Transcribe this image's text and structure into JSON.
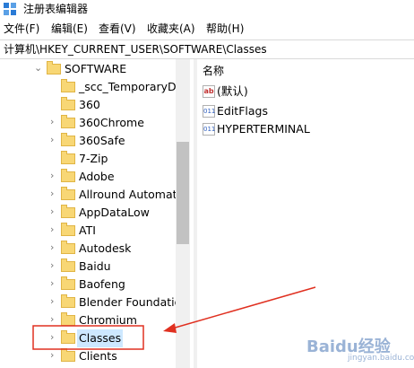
{
  "window": {
    "title": "注册表编辑器"
  },
  "menu": [
    "文件(F)",
    "编辑(E)",
    "查看(V)",
    "收藏夹(A)",
    "帮助(H)"
  ],
  "address": "计算机\\HKEY_CURRENT_USER\\SOFTWARE\\Classes",
  "tree": {
    "parent": "SOFTWARE",
    "items": [
      {
        "label": "_scc_TemporaryDa",
        "expandable": false
      },
      {
        "label": "360",
        "expandable": false
      },
      {
        "label": "360Chrome",
        "expandable": true
      },
      {
        "label": "360Safe",
        "expandable": true
      },
      {
        "label": "7-Zip",
        "expandable": false
      },
      {
        "label": "Adobe",
        "expandable": true
      },
      {
        "label": "Allround Automatio",
        "expandable": true
      },
      {
        "label": "AppDataLow",
        "expandable": true
      },
      {
        "label": "ATI",
        "expandable": true
      },
      {
        "label": "Autodesk",
        "expandable": true
      },
      {
        "label": "Baidu",
        "expandable": true
      },
      {
        "label": "Baofeng",
        "expandable": true
      },
      {
        "label": "Blender Foundation",
        "expandable": true
      },
      {
        "label": "Chromium",
        "expandable": true
      },
      {
        "label": "Classes",
        "expandable": true,
        "selected": true
      },
      {
        "label": "Clients",
        "expandable": true
      }
    ]
  },
  "values": {
    "header": "名称",
    "items": [
      {
        "icon": "string-value-icon",
        "label": "(默认)"
      },
      {
        "icon": "binary-value-icon",
        "label": "EditFlags"
      },
      {
        "icon": "binary-value-icon",
        "label": "HYPERTERMINAL"
      }
    ]
  },
  "watermark": {
    "brand": "Baidu经验",
    "sub": "jingyan.baidu.com"
  },
  "colors": {
    "selection": "#cde8ff",
    "annotation": "#e03020",
    "folder": "#f8d775"
  }
}
